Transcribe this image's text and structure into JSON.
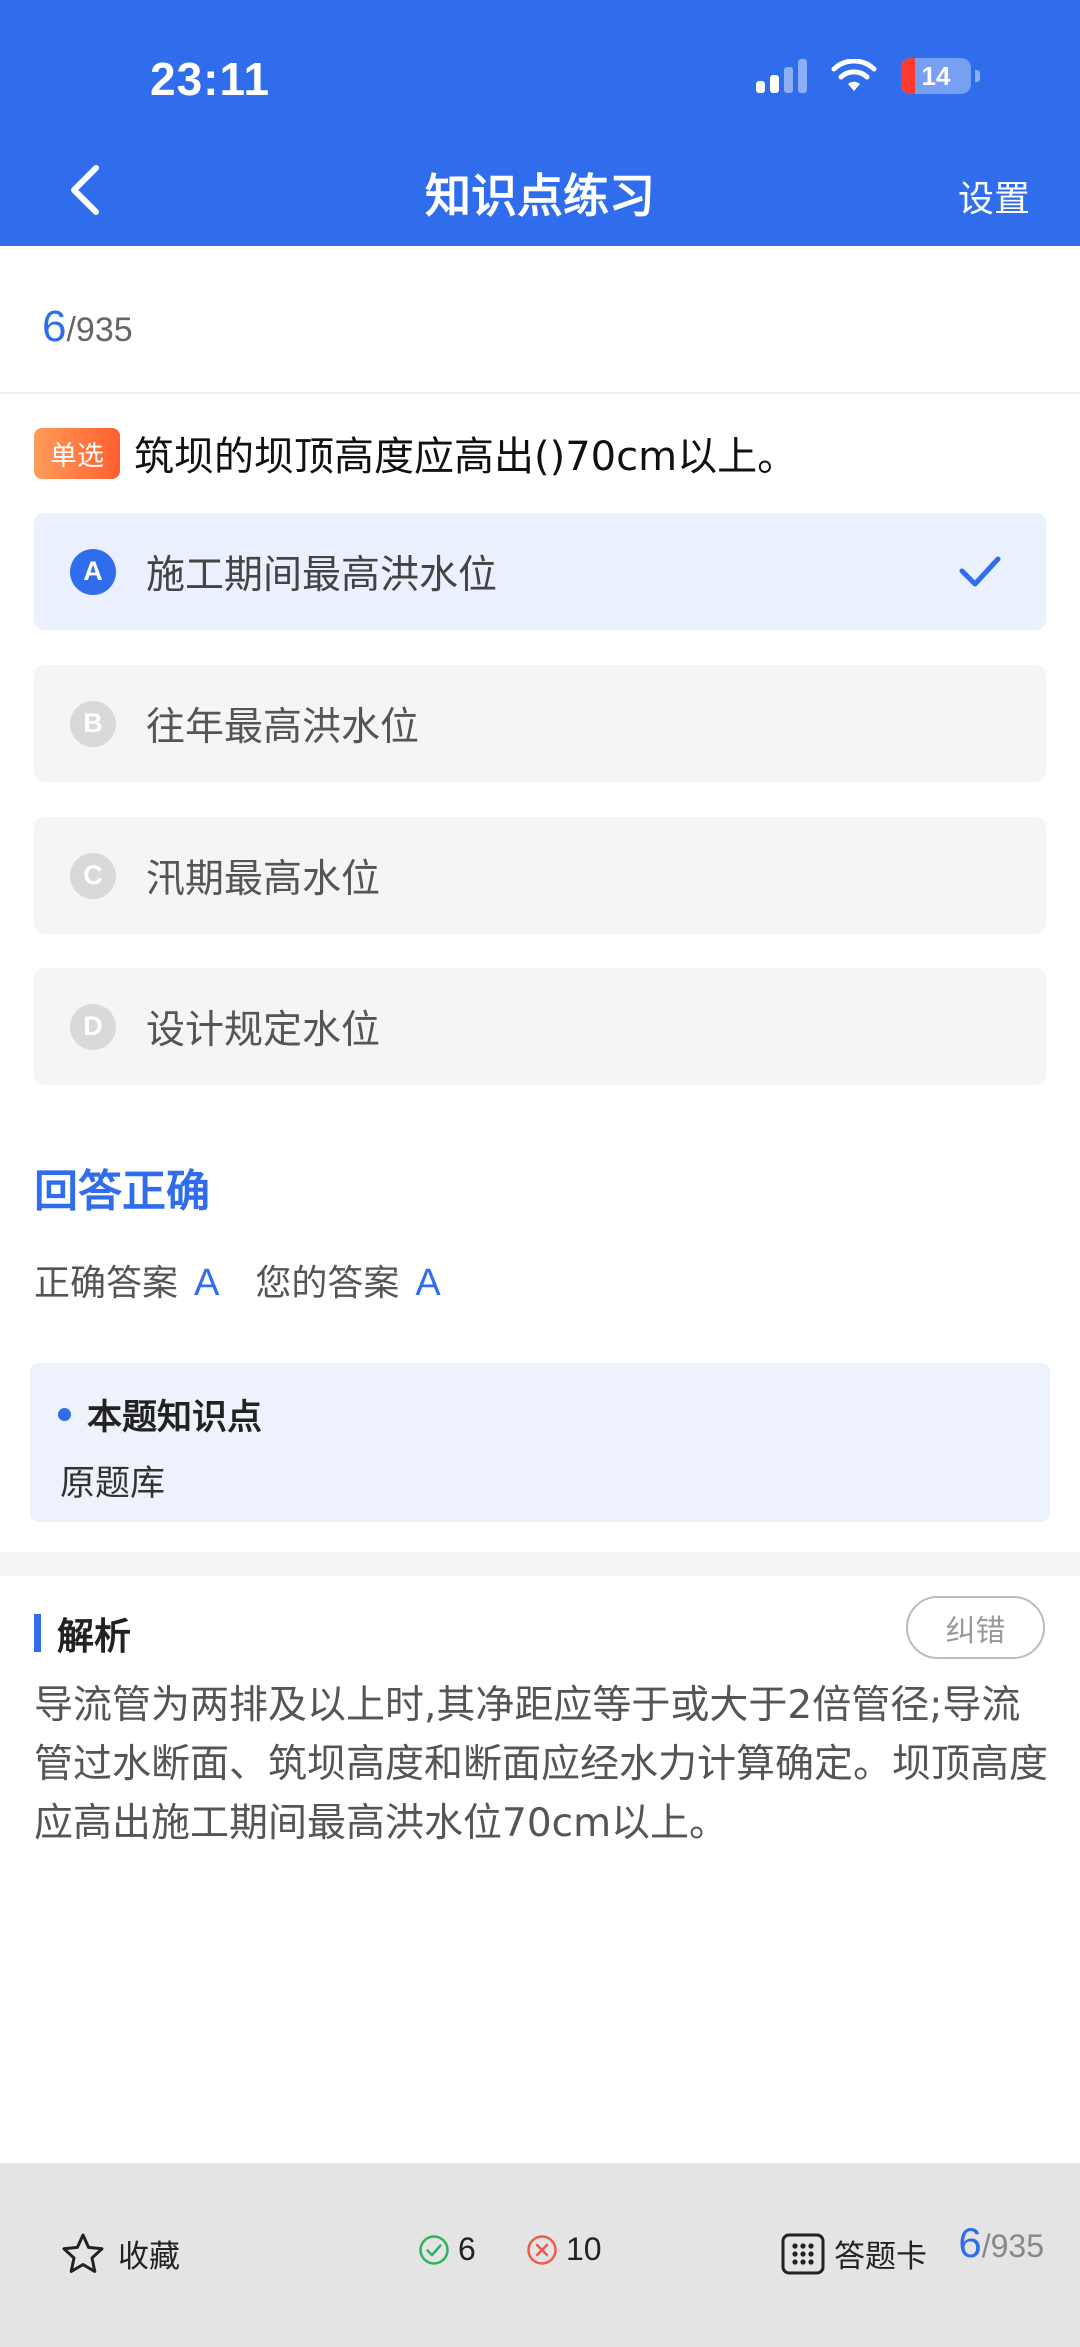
{
  "status_bar": {
    "time": "23:11",
    "battery": "14"
  },
  "nav": {
    "title": "知识点练习",
    "settings_label": "设置"
  },
  "progress": {
    "current": "6",
    "total": "/935"
  },
  "question": {
    "type_tag": "单选",
    "text": "筑坝的坝顶高度应高出()70cm以上。",
    "options": [
      {
        "letter": "A",
        "text": "施工期间最高洪水位",
        "state": "correct-selected"
      },
      {
        "letter": "B",
        "text": "往年最高洪水位",
        "state": "normal"
      },
      {
        "letter": "C",
        "text": "汛期最高水位",
        "state": "normal"
      },
      {
        "letter": "D",
        "text": "设计规定水位",
        "state": "normal"
      }
    ]
  },
  "result": {
    "title": "回答正确",
    "correct_label": "正确答案",
    "correct_value": "A",
    "your_label": "您的答案",
    "your_value": "A"
  },
  "knowledge_point": {
    "heading": "本题知识点",
    "content": "原题库"
  },
  "analysis": {
    "title": "解析",
    "report_label": "纠错",
    "text": "导流管为两排及以上时,其净距应等于或大于2倍管径;导流管过水断面、筑坝高度和断面应经水力计算确定。坝顶高度应高出施工期间最高洪水位70cm以上。"
  },
  "bottom_bar": {
    "favorite_label": "收藏",
    "right_count": "6",
    "wrong_count": "10",
    "card_label": "答题卡",
    "progress_current": "6",
    "progress_total": "/935"
  },
  "colors": {
    "primary": "#2f6ded",
    "tag_orange": "#ff6a33",
    "right_green": "#2fb160",
    "wrong_red": "#ef5a4a"
  }
}
